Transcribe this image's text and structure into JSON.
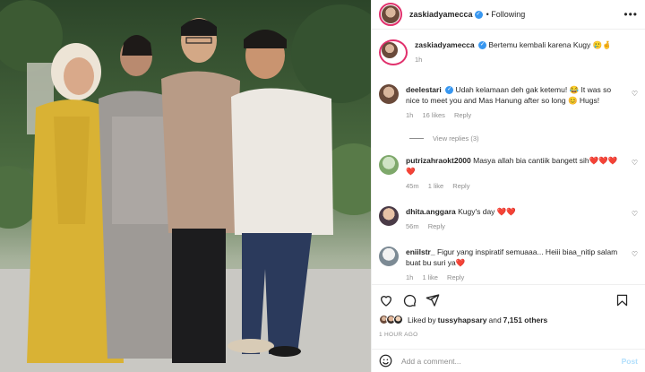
{
  "header": {
    "username": "zaskiadyamecca",
    "follow_status": "• Following"
  },
  "caption": {
    "username": "zaskiadyamecca",
    "text": "Bertemu kembali karena Kugy 🥲🤞",
    "time": "1h"
  },
  "comments": [
    {
      "username": "deelestari",
      "verified": true,
      "text": "Udah kelamaan deh gak ketemu! 😂 It was so nice to meet you and Mas Hanung after so long 😊 Hugs!",
      "time": "1h",
      "likes": "16 likes",
      "reply": "Reply",
      "view_replies": "View replies (3)"
    },
    {
      "username": "putrizahraokt2000",
      "verified": false,
      "text": "Masya allah bia cantiik bangett sih❤️❤️❤️❤️",
      "time": "45m",
      "likes": "1 like",
      "reply": "Reply"
    },
    {
      "username": "dhita.anggara",
      "verified": false,
      "text": "Kugy's day ❤️❤️",
      "time": "56m",
      "likes": "",
      "reply": "Reply"
    },
    {
      "username": "eniilstr_",
      "verified": false,
      "text": "Figur yang inspiratif semuaaa... Heiii biaa_nitip salam buat bu suri ya❤️",
      "time": "1h",
      "likes": "1 like",
      "reply": "Reply"
    }
  ],
  "likes": {
    "prefix": "Liked by ",
    "user": "tussyhapsary",
    "middle": " and ",
    "others": "7,151 others"
  },
  "timestamp": "1 HOUR AGO",
  "composer": {
    "placeholder": "Add a comment...",
    "post_label": "Post"
  },
  "icons": {
    "like": "heart-icon",
    "comment": "comment-icon",
    "share": "share-icon",
    "save": "bookmark-icon",
    "emoji": "emoji-icon",
    "more": "more-icon"
  },
  "colors": {
    "verified": "#3897f0",
    "meta": "#8e8e8e",
    "post_disabled": "#b2dffc"
  }
}
